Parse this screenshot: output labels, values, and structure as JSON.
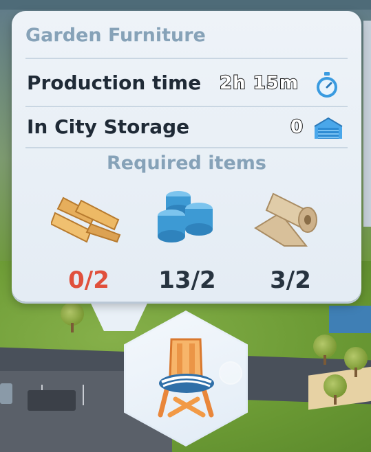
{
  "tooltip": {
    "title": "Garden Furniture",
    "production_time_label": "Production time",
    "production_time_value": "2h 15m",
    "storage_label": "In City Storage",
    "storage_value": "0",
    "required_title": "Required items",
    "required_items": [
      {
        "icon": "wood-planks-icon",
        "count": "0/2",
        "status": "insufficient"
      },
      {
        "icon": "plastic-icon",
        "count": "13/2",
        "status": "ok"
      },
      {
        "icon": "textile-roll-icon",
        "count": "3/2",
        "status": "ok"
      }
    ]
  },
  "product_button": {
    "icon": "garden-chair-icon"
  },
  "colors": {
    "title": "#86a2b8",
    "insufficient": "#e0503c",
    "ok": "#27333f",
    "panel": "#eef3f8"
  }
}
